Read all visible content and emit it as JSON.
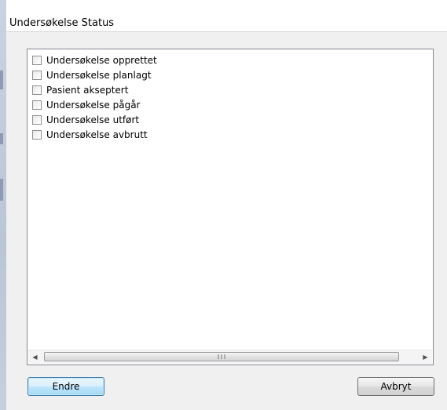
{
  "dialog": {
    "title": "Undersøkelse Status"
  },
  "status_list": {
    "items": [
      {
        "label": "Undersøkelse opprettet",
        "checked": false
      },
      {
        "label": "Undersøkelse planlagt",
        "checked": false
      },
      {
        "label": "Pasient akseptert",
        "checked": false
      },
      {
        "label": "Undersøkelse pågår",
        "checked": false
      },
      {
        "label": "Undersøkelse utført",
        "checked": false
      },
      {
        "label": "Undersøkelse avbrutt",
        "checked": false
      }
    ]
  },
  "scrollbar": {
    "left_arrow_icon": "arrow-left-icon",
    "right_arrow_icon": "arrow-right-icon",
    "grip_icon": "scroll-grip-icon"
  },
  "buttons": {
    "change_label": "Endre",
    "cancel_label": "Avbryt"
  },
  "colors": {
    "accent": "#3c7fb1",
    "dialog_bg": "#f0f0f0"
  }
}
